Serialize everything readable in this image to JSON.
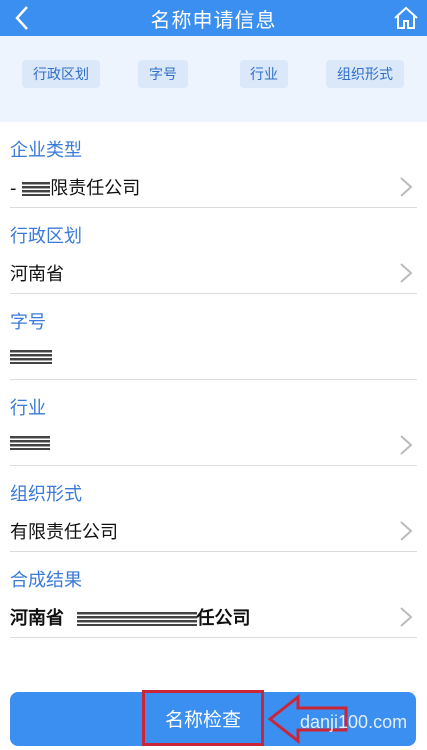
{
  "header": {
    "title": "名称申请信息",
    "back_icon": "chevron-left-icon",
    "home_icon": "home-icon"
  },
  "chips": [
    "行政区划",
    "字号",
    "行业",
    "组织形式"
  ],
  "form": {
    "rows": [
      {
        "label": "企业类型",
        "value_suffix": "限责任公司",
        "has_chevron": true
      },
      {
        "label": "行政区划",
        "value": "河南省",
        "has_chevron": true
      },
      {
        "label": "字号",
        "has_chevron": false
      },
      {
        "label": "行业",
        "has_chevron": true
      },
      {
        "label": "组织形式",
        "value": "有限责任公司",
        "has_chevron": true
      },
      {
        "label": "合成结果",
        "value_prefix": "河南省",
        "value_suffix": "任公司",
        "has_chevron": true
      }
    ]
  },
  "bottom": {
    "check_label": "名称检查"
  },
  "watermark": "danji100.com",
  "colors": {
    "primary": "#3a8ff0",
    "label": "#3a7ad8",
    "highlight": "#c9263a"
  }
}
